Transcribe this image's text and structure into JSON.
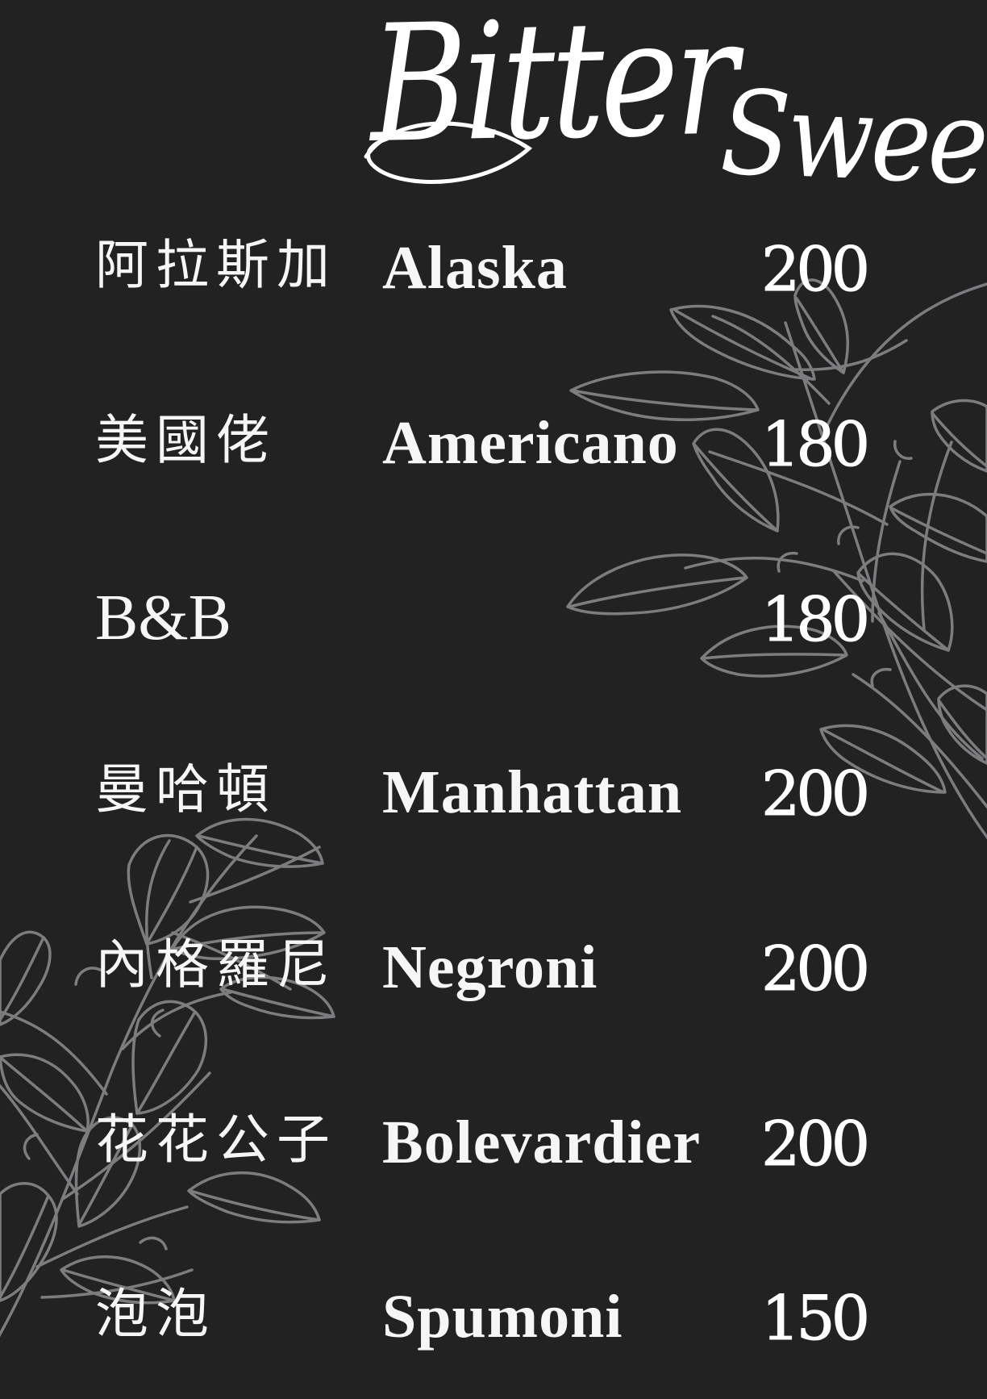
{
  "brand": {
    "title_first": "Bitter",
    "title_second": "Sweet"
  },
  "menu": {
    "items": [
      {
        "name_zh": "阿拉斯加",
        "name_en": "Alaska",
        "price": "200"
      },
      {
        "name_zh": "美國佬",
        "name_en": "Americano",
        "price": "180"
      },
      {
        "name_zh": "B&B",
        "name_en": "",
        "price": "180"
      },
      {
        "name_zh": "曼哈頓",
        "name_en": "Manhattan",
        "price": "200"
      },
      {
        "name_zh": "內格羅尼",
        "name_en": "Negroni",
        "price": "200"
      },
      {
        "name_zh": "花花公子",
        "name_en": "Bolevardier",
        "price": "200"
      },
      {
        "name_zh": "泡泡",
        "name_en": "Spumoni",
        "price": "150"
      }
    ]
  },
  "decor": {
    "leaf_icon": "leaf-branch-icon",
    "leaf_color": "#8c8c8f",
    "background_color": "#222223"
  }
}
